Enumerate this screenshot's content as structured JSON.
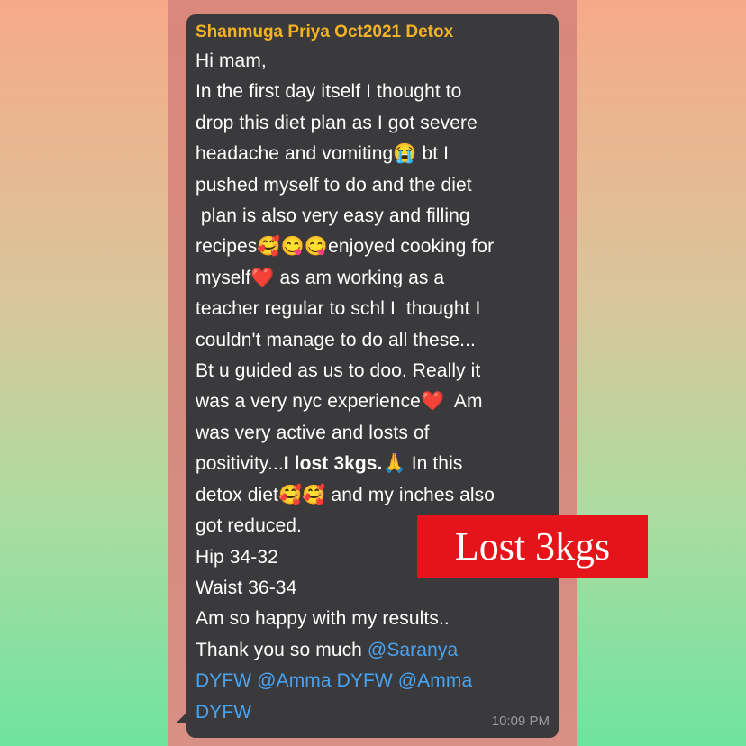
{
  "message": {
    "sender": "Shanmuga Priya Oct2021 Detox",
    "lines": [
      "Hi mam,",
      "In the first day itself I thought to",
      "drop this diet plan as I got severe",
      "headache and vomiting😭 bt I",
      "pushed myself to do and the diet",
      " plan is also very easy and filling",
      "recipes🥰😋😋enjoyed cooking for",
      "myself❤️ as am working as a",
      "teacher regular to schl I  thought I",
      "couldn't manage to do all these...",
      "Bt u guided as us to doo. Really it",
      "was a very nyc experience❤️  Am",
      "was very active and losts of"
    ],
    "line14": {
      "pre": "positivity...",
      "bold": "I lost 3kgs.",
      "post": "🙏 In this"
    },
    "lines2": [
      "detox diet🥰🥰 and my inches also",
      "got reduced.",
      "Hip 34-32",
      "Waist 36-34",
      "Am so happy with my results.."
    ],
    "thanks": "Thank you so much ",
    "mention1a": "@Saranya",
    "mention1b": "DYFW",
    "mention2": "@Amma DYFW",
    "mention3a": "@Amma",
    "mention3b": "DYFW",
    "time": "10:09 PM"
  },
  "stamp": {
    "text": "Lost 3kgs",
    "color": "#e5141a"
  },
  "colors": {
    "bubble": "#3a3a3c",
    "sender": "#f2b324",
    "mention": "#4aa3f0"
  }
}
